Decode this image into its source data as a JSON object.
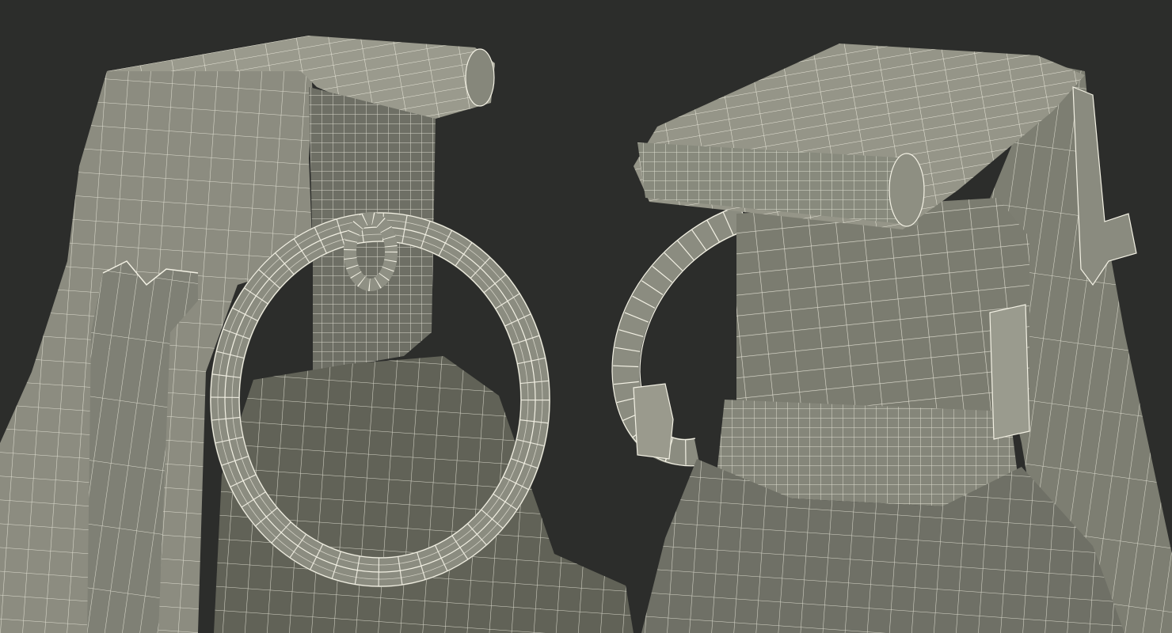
{
  "scene": {
    "subject": "wireframe-render",
    "colors": {
      "background": "#2c2d2b",
      "surface_light": "#8f8f82",
      "surface_mid": "#7b7c70",
      "surface_dark": "#5e5f56",
      "surface_shadow": "#4a4b44",
      "wire": "#f3f1e4"
    }
  }
}
